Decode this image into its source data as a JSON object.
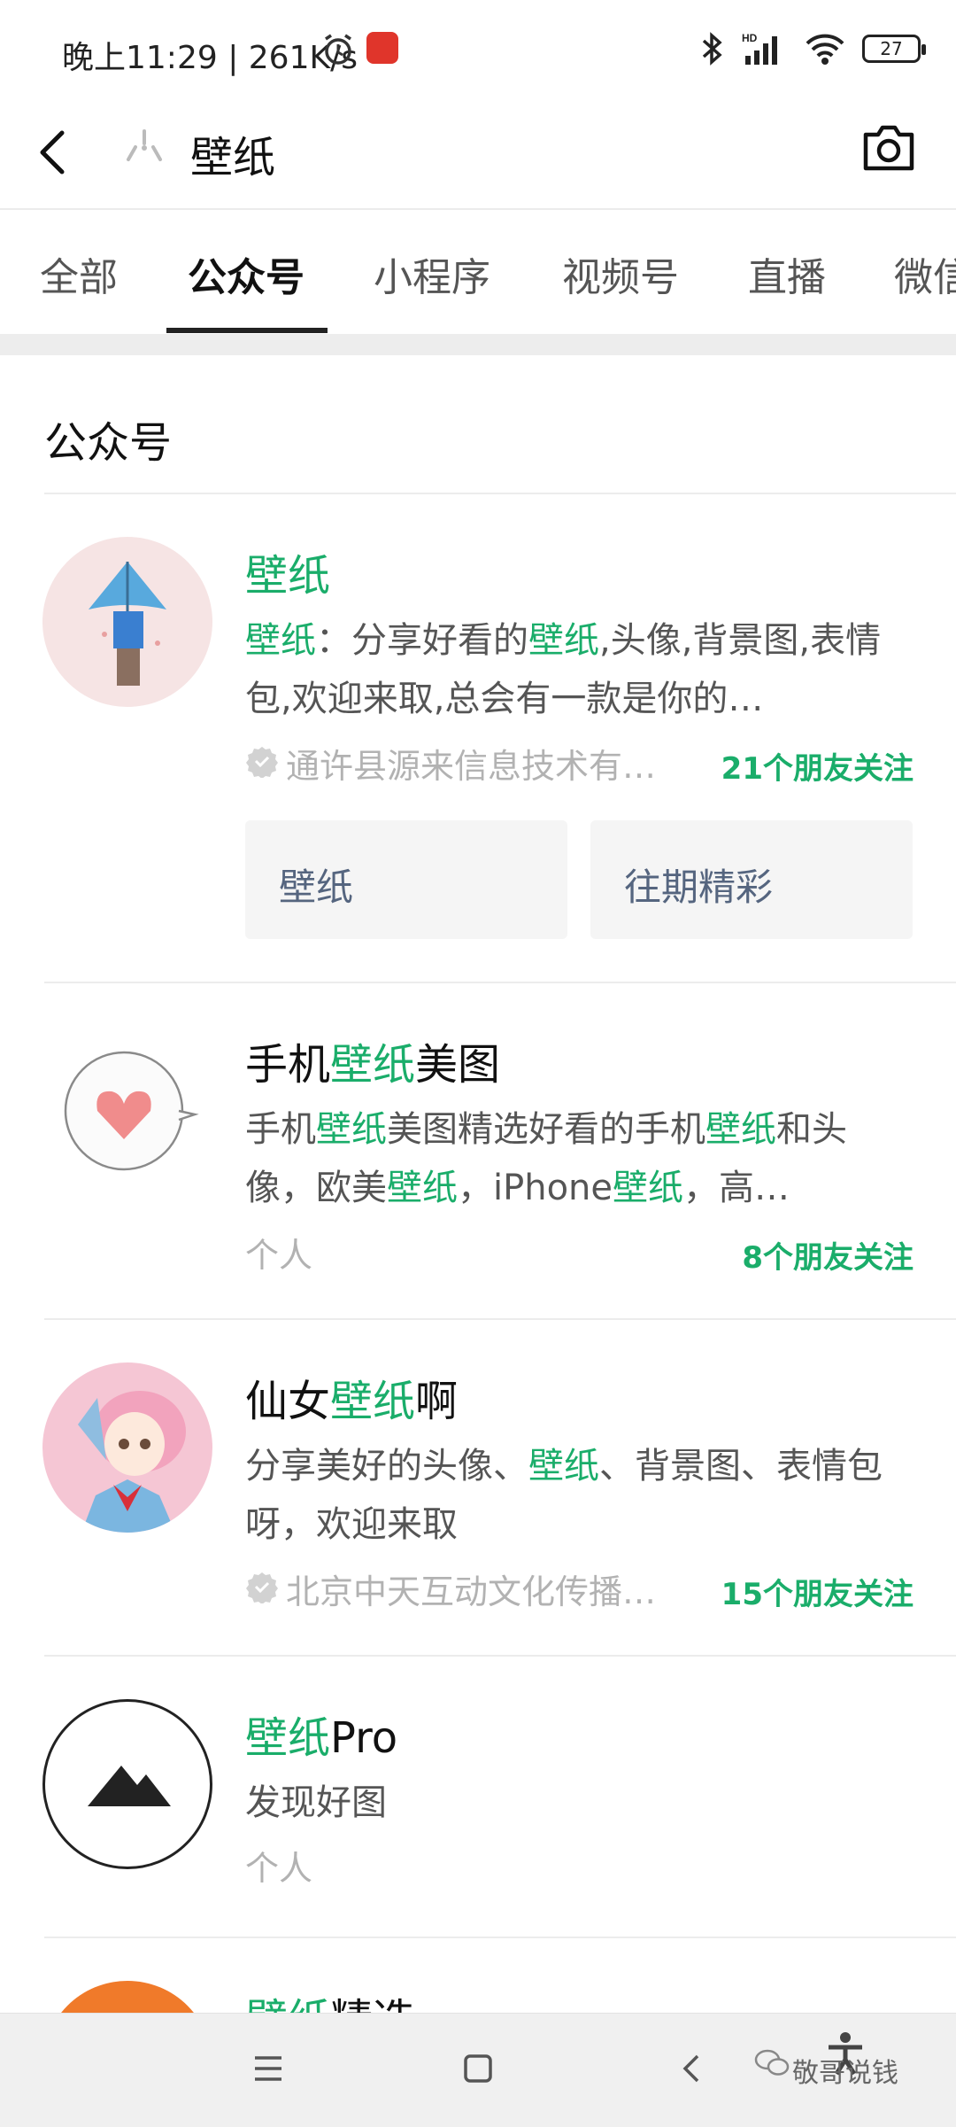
{
  "status_bar": {
    "time": "晚上11:29 | 261K/s",
    "battery": "27"
  },
  "header": {
    "query": "壁纸"
  },
  "tabs": [
    {
      "label": "全部"
    },
    {
      "label": "公众号"
    },
    {
      "label": "小程序"
    },
    {
      "label": "视频号"
    },
    {
      "label": "直播"
    },
    {
      "label": "微信"
    }
  ],
  "section_title": "公众号",
  "results": [
    {
      "title_hl": "壁纸",
      "title_rest": "",
      "desc_parts": [
        "壁纸",
        "：分享好看的",
        "壁纸",
        ",头像,背景图,表情包,欢迎来取,总会有一款是你的…"
      ],
      "verified_org": "通许县源来信息技术有…",
      "followers": "21个朋友关注",
      "menu": [
        "壁纸",
        "往期精彩"
      ]
    },
    {
      "title_pre": "手机",
      "title_hl": "壁纸",
      "title_rest": "美图",
      "desc_parts": [
        "手机",
        "壁纸",
        "美图精选好看的手机",
        "壁纸",
        "和头像，欧美",
        "壁纸",
        "，iPhone",
        "壁纸",
        "，高…"
      ],
      "type": "个人",
      "followers": "8个朋友关注"
    },
    {
      "title_pre": "仙女",
      "title_hl": "壁纸",
      "title_rest": "啊",
      "desc_parts": [
        "分享美好的头像、",
        "壁纸",
        "、背景图、表情包呀，欢迎来取"
      ],
      "verified_org": "北京中天互动文化传播…",
      "followers": "15个朋友关注"
    },
    {
      "title_hl": "壁纸",
      "title_rest": "Pro",
      "desc": "发现好图",
      "type": "个人"
    },
    {
      "title_hl": "壁纸",
      "title_rest": "精选"
    }
  ],
  "watermark": "敬哥说钱",
  "colors": {
    "highlight": "#1aad6a",
    "menu_text": "#55657f",
    "secondary": "#b2b2b2"
  }
}
